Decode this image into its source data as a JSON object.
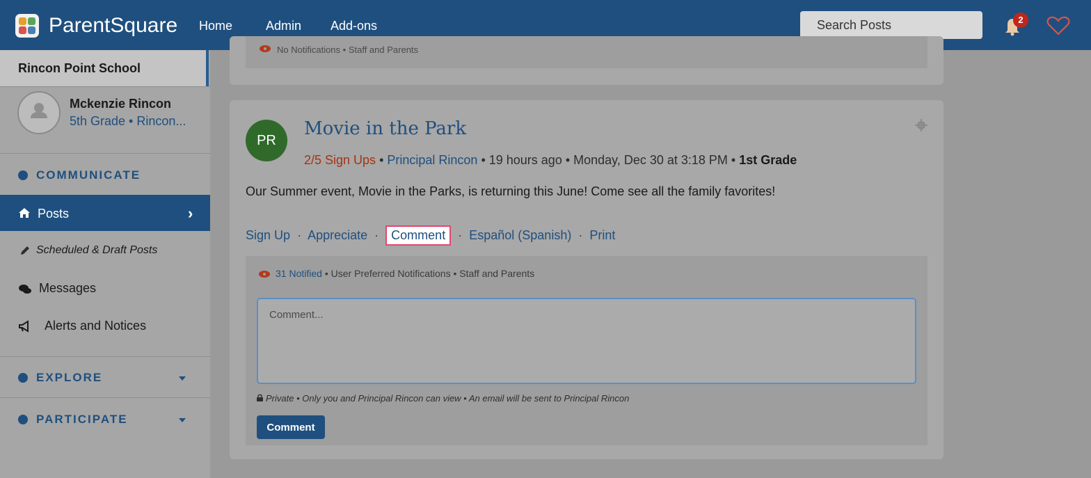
{
  "app": {
    "brand": "ParentSquare",
    "nav": [
      "Home",
      "Admin",
      "Add-ons"
    ],
    "search_placeholder": "Search Posts",
    "notification_count": "2",
    "accent_color": "#1f4f7e"
  },
  "sidebar": {
    "school": "Rincon Point School",
    "user_name": "Mckenzie Rincon",
    "user_sub": "5th Grade • Rincon...",
    "sections": {
      "communicate": "COMMUNICATE",
      "explore": "EXPLORE",
      "participate": "PARTICIPATE"
    },
    "items": {
      "posts": "Posts",
      "scheduled": "Scheduled & Draft Posts",
      "messages": "Messages",
      "alerts": "Alerts and Notices"
    }
  },
  "previous_post": {
    "notifications": "No Notifications • Staff and Parents"
  },
  "post": {
    "avatar_initials": "PR",
    "title": "Movie in the Park",
    "signups": "2/5 Sign Ups",
    "sep1": " • ",
    "author": "Principal Rincon",
    "time": " • 19 hours ago • Monday, Dec 30 at 3:18 PM • ",
    "grade": "1st Grade",
    "body": "Our Summer event, Movie in the Parks, is returning this June! Come see all the family favorites!",
    "actions": {
      "signup": "Sign Up",
      "appreciate": "Appreciate",
      "comment": "Comment",
      "spanish": "Español (Spanish)",
      "print": "Print",
      "sep": "·"
    },
    "notified": "31 Notified",
    "notif_rest": " • User Preferred Notifications • Staff and Parents",
    "comment_placeholder": "Comment...",
    "private_note": "Private • Only you and Principal Rincon can view • An email will be sent to Principal Rincon",
    "submit_label": "Comment"
  }
}
